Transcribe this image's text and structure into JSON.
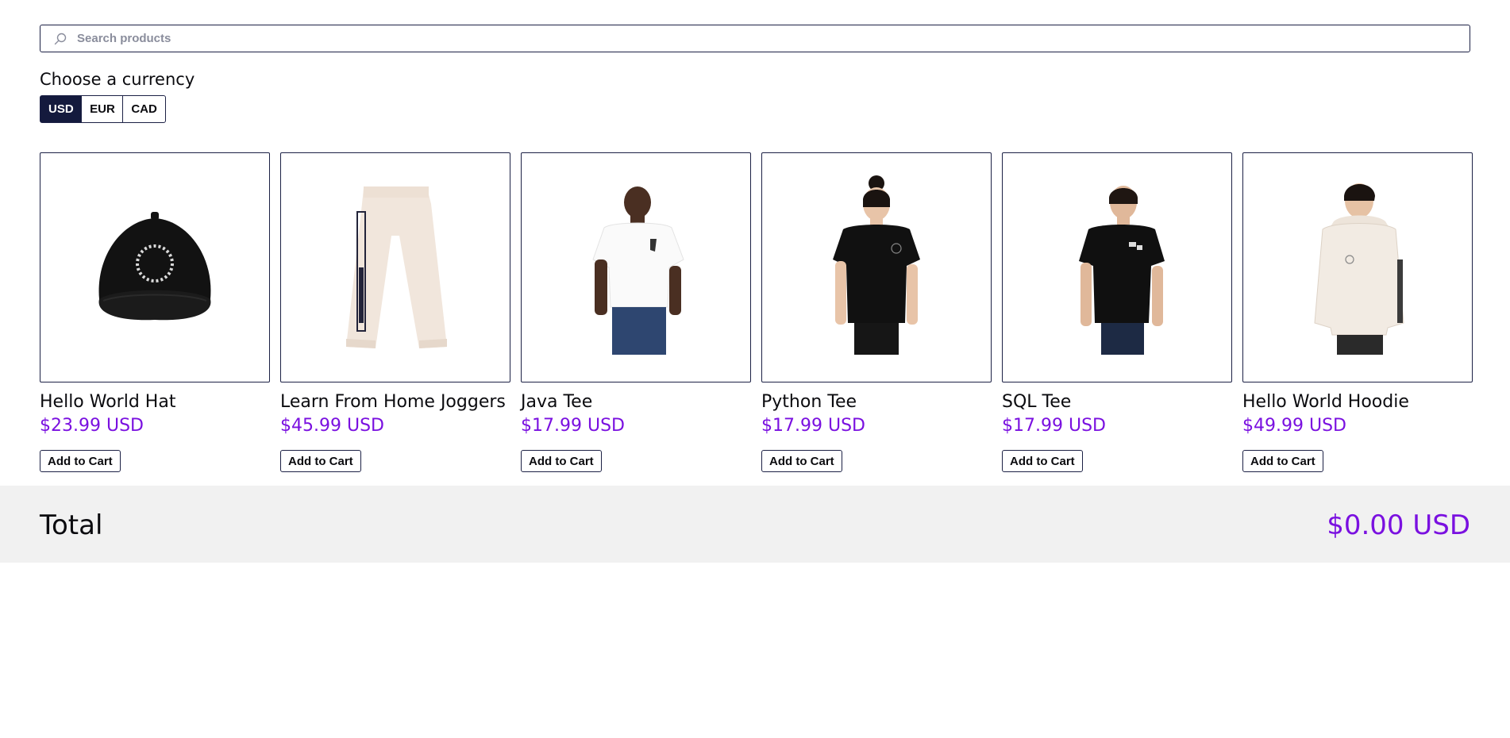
{
  "search": {
    "placeholder": "Search products",
    "value": ""
  },
  "currency": {
    "title": "Choose a currency",
    "options": [
      "USD",
      "EUR",
      "CAD"
    ],
    "selected": "USD"
  },
  "products": [
    {
      "name": "Hello World Hat",
      "price": "$23.99 USD",
      "button": "Add to Cart",
      "image_icon": "cap-icon"
    },
    {
      "name": "Learn From Home Joggers",
      "price": "$45.99 USD",
      "button": "Add to Cart",
      "image_icon": "joggers-icon"
    },
    {
      "name": "Java Tee",
      "price": "$17.99 USD",
      "button": "Add to Cart",
      "image_icon": "white-tee-icon"
    },
    {
      "name": "Python Tee",
      "price": "$17.99 USD",
      "button": "Add to Cart",
      "image_icon": "black-tee-icon"
    },
    {
      "name": "SQL Tee",
      "price": "$17.99 USD",
      "button": "Add to Cart",
      "image_icon": "black-tee-icon"
    },
    {
      "name": "Hello World Hoodie",
      "price": "$49.99 USD",
      "button": "Add to Cart",
      "image_icon": "hoodie-icon"
    }
  ],
  "total": {
    "label": "Total",
    "value": "$0.00 USD"
  },
  "colors": {
    "accent": "#7a10e0",
    "border": "#1c2145",
    "selected_currency_bg": "#141a3d",
    "total_bar_bg": "#f1f1f1"
  }
}
